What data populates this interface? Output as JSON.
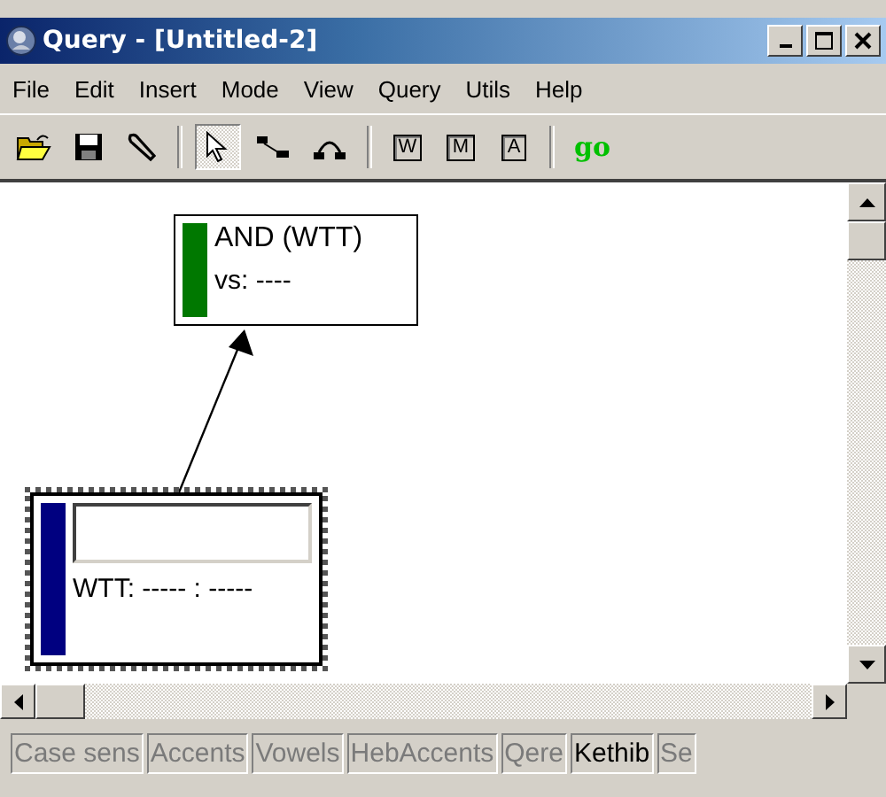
{
  "window": {
    "title": "Query - [Untitled-2]"
  },
  "menu": [
    "File",
    "Edit",
    "Insert",
    "Mode",
    "View",
    "Query",
    "Utils",
    "Help"
  ],
  "toolbar": [
    [
      {
        "kind": "open",
        "selected": false
      },
      {
        "kind": "save",
        "selected": false
      },
      {
        "kind": "wrench",
        "selected": false
      }
    ],
    [
      {
        "kind": "pointer",
        "selected": true
      },
      {
        "kind": "link",
        "selected": false
      },
      {
        "kind": "arc",
        "selected": false
      }
    ],
    [
      {
        "kind": "letter",
        "label": "W",
        "selected": false
      },
      {
        "kind": "letter",
        "label": "M",
        "selected": false
      },
      {
        "kind": "letter",
        "label": "A",
        "selected": false
      }
    ],
    [
      {
        "kind": "go",
        "label": "go",
        "selected": false
      }
    ]
  ],
  "canvas": {
    "nodes": [
      {
        "kind": "operator",
        "title": "AND (WTT)",
        "subtitle": "vs: ----",
        "color": "#007800",
        "selected": false
      },
      {
        "kind": "word",
        "subtitle": "WTT: ----- : -----",
        "color": "#000080",
        "selected": true
      }
    ]
  },
  "status_bar": [
    {
      "label": "Case sens",
      "disabled": true
    },
    {
      "label": "Accents",
      "disabled": true
    },
    {
      "label": "Vowels",
      "disabled": true
    },
    {
      "label": "HebAccents",
      "disabled": true
    },
    {
      "label": "Qere",
      "disabled": true
    },
    {
      "label": "Kethib",
      "disabled": false
    },
    {
      "label": "Se",
      "disabled": true
    }
  ]
}
